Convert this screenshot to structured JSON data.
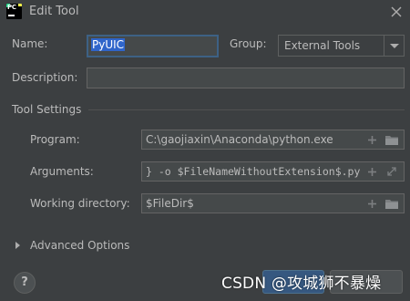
{
  "window": {
    "title": "Edit Tool",
    "app_icon_text": "PC"
  },
  "form": {
    "name_label": "Name:",
    "name_value": "PyUIC",
    "group_label": "Group:",
    "group_value": "External Tools",
    "description_label": "Description:",
    "description_value": ""
  },
  "tool_settings": {
    "title": "Tool Settings",
    "program_label": "Program:",
    "program_value": "C:\\gaojiaxin\\Anaconda\\python.exe",
    "arguments_label": "Arguments:",
    "arguments_value": "} -o $FileNameWithoutExtension$.py",
    "working_dir_label": "Working directory:",
    "working_dir_value": "$FileDir$"
  },
  "advanced": {
    "label": "Advanced Options"
  },
  "footer": {
    "help_label": "?",
    "watermark": "CSDN @攻城狮不暴燥"
  },
  "colors": {
    "background": "#3c3f41",
    "field_bg": "#45494a",
    "selection": "#2f65ca",
    "focus_border": "#3d6185",
    "ok_button": "#365880"
  }
}
